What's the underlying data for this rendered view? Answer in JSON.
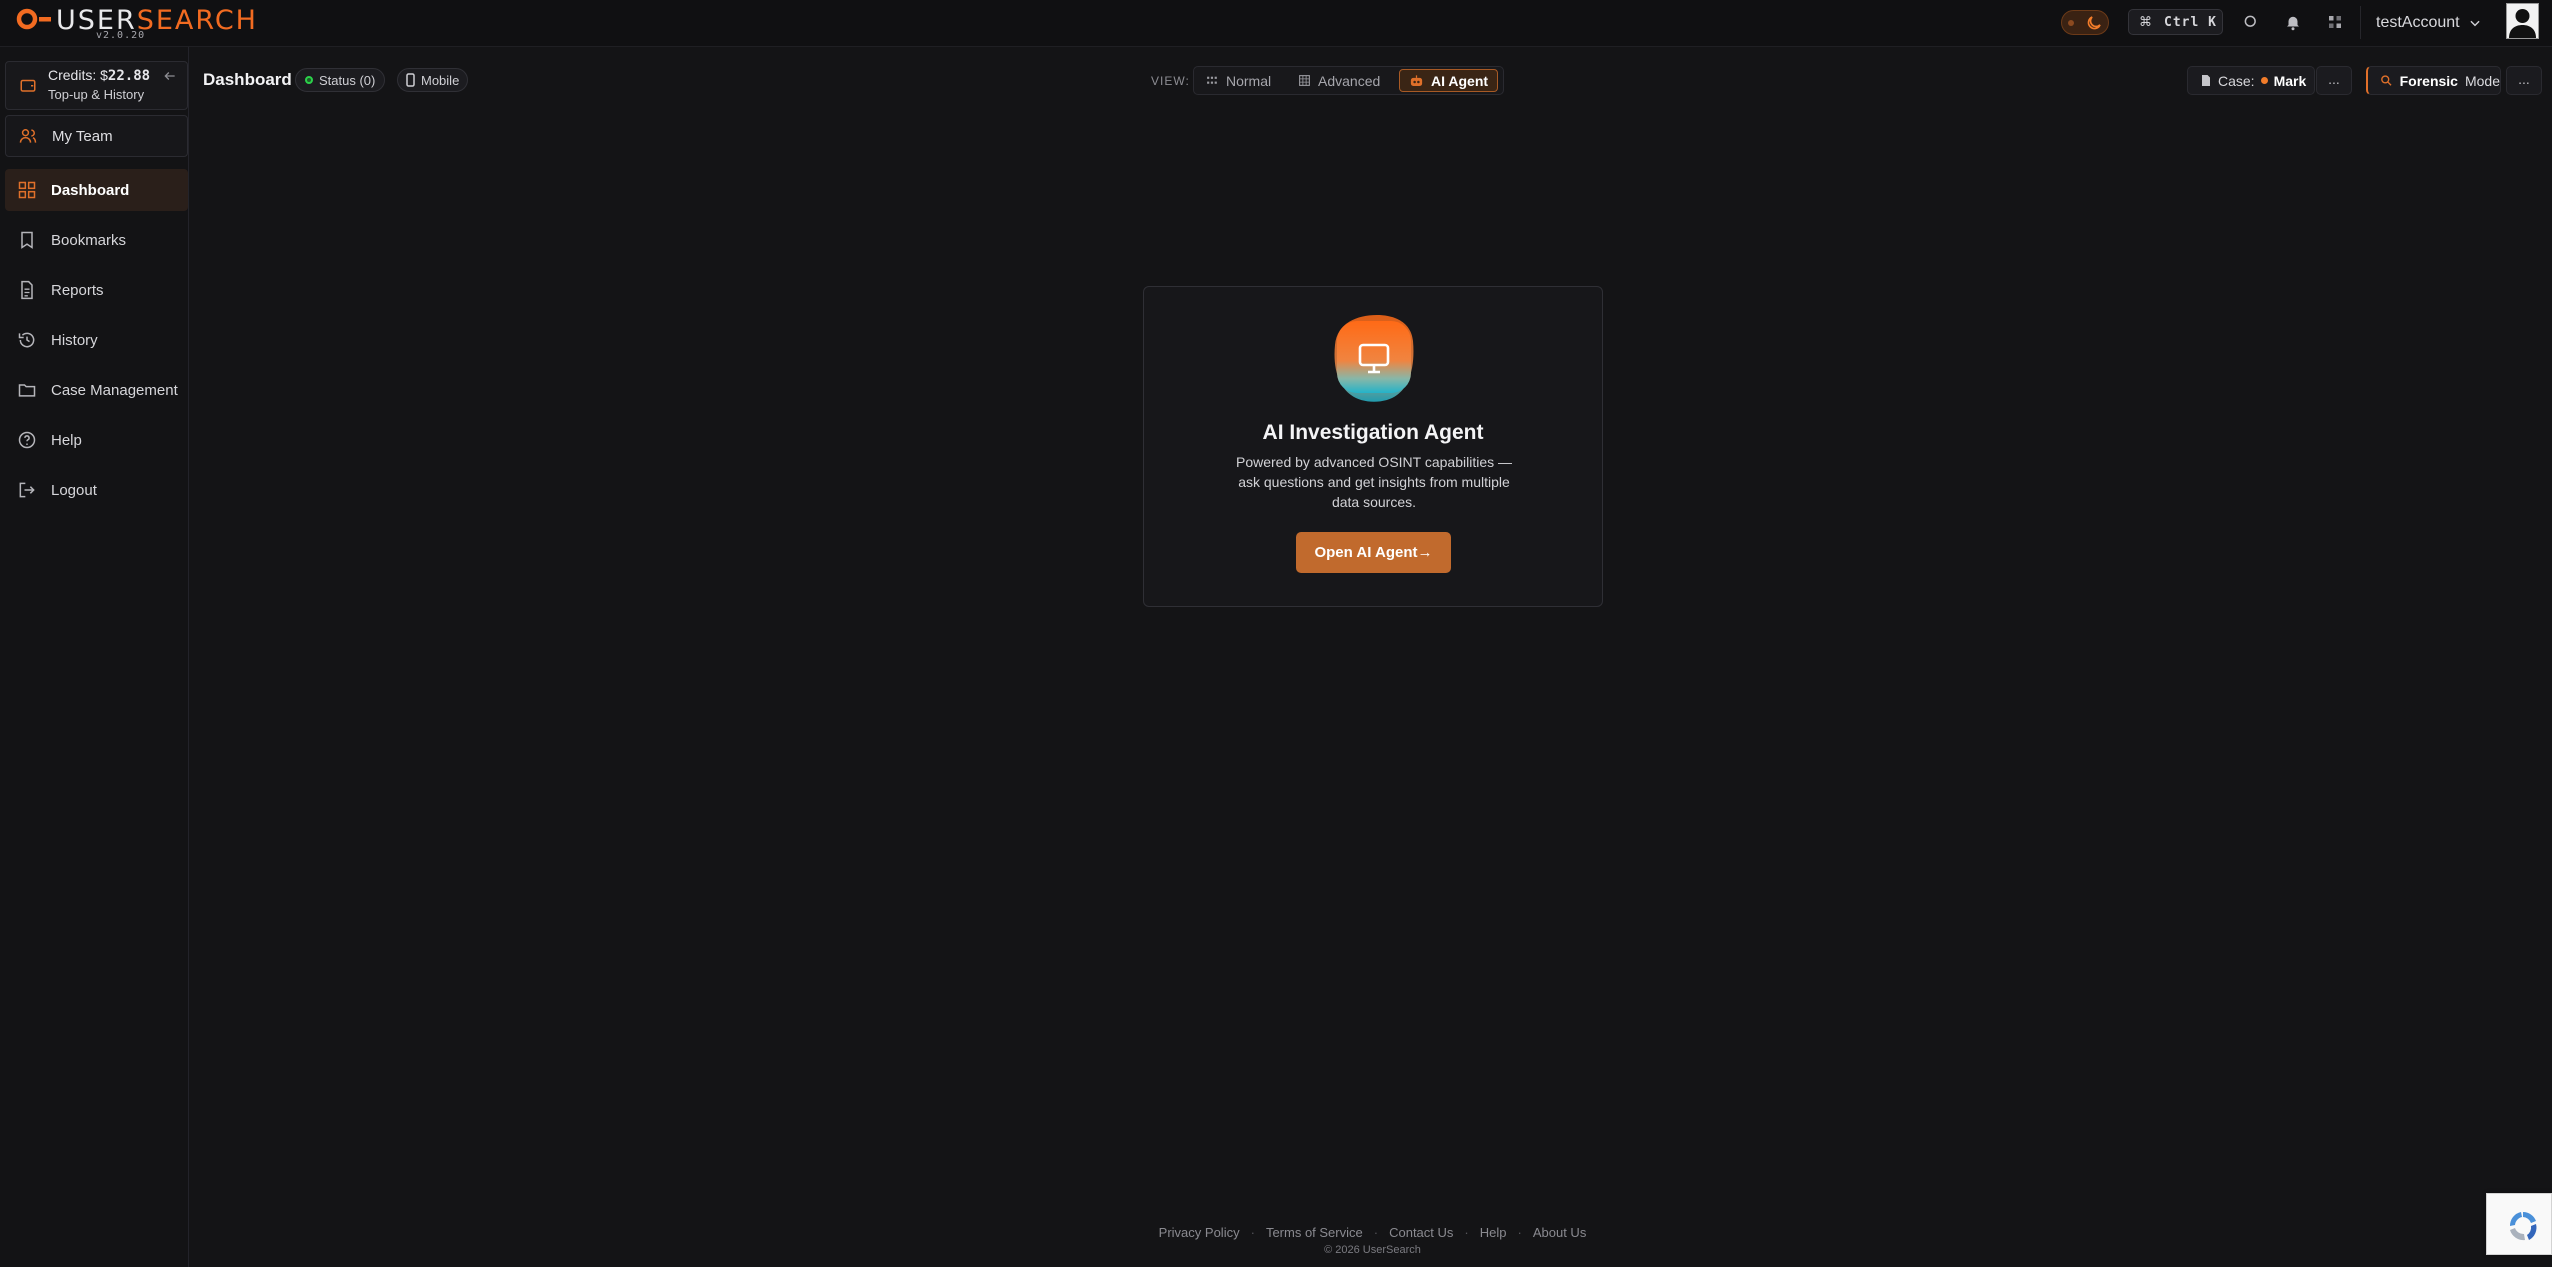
{
  "brand": {
    "name_part1": "USER",
    "name_part2": "SEARCH",
    "version": "v2.0.20",
    "accent_color": "#f26b21"
  },
  "topbar": {
    "shortcut_symbol": "⌘",
    "shortcut_key": "Ctrl K",
    "icons": [
      "moon-icon",
      "search-icon",
      "bell-icon",
      "apps-icon"
    ],
    "user_name": "testAccount"
  },
  "sidebar": {
    "credits_prefix": "Credits: $",
    "credits_amount": "22.88",
    "topup_label": "Top-up & History",
    "team_label": "My Team",
    "items": [
      {
        "label": "Dashboard",
        "icon": "grid-icon",
        "active": true
      },
      {
        "label": "Bookmarks",
        "icon": "bookmark-icon",
        "active": false
      },
      {
        "label": "Reports",
        "icon": "document-icon",
        "active": false
      },
      {
        "label": "History",
        "icon": "history-icon",
        "active": false
      },
      {
        "label": "Case Management",
        "icon": "folder-icon",
        "active": false
      },
      {
        "label": "Help",
        "icon": "help-icon",
        "active": false
      },
      {
        "label": "Logout",
        "icon": "logout-icon",
        "active": false
      }
    ]
  },
  "header": {
    "title": "Dashboard",
    "status_label": "Status (0)",
    "mobile_label": "Mobile",
    "view_label": "VIEW:",
    "views": [
      {
        "label": "Normal",
        "active": false
      },
      {
        "label": "Advanced",
        "active": false
      },
      {
        "label": "AI Agent",
        "active": true
      }
    ],
    "case_label": "Case:",
    "case_name": "Mark",
    "more_label": "...",
    "forensic_label_1": "Forensic",
    "forensic_label_2": "Mode"
  },
  "agent_card": {
    "title": "AI Investigation Agent",
    "description": "Powered by advanced OSINT capabilities — ask questions and get insights from multiple data sources.",
    "button_label": "Open AI Agent→"
  },
  "footer": {
    "links": [
      "Privacy Policy",
      "Terms of Service",
      "Contact Us",
      "Help",
      "About Us"
    ],
    "separator": "·",
    "copyright": "© 2026 UserSearch"
  }
}
